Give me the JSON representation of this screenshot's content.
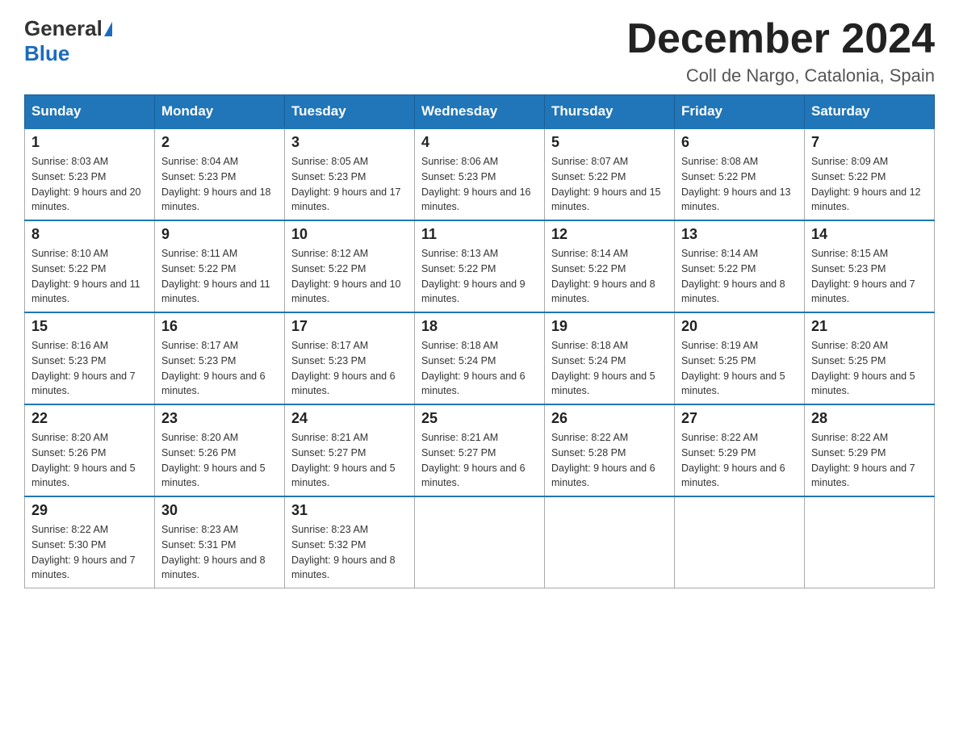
{
  "logo": {
    "general": "General",
    "blue": "Blue"
  },
  "title": "December 2024",
  "location": "Coll de Nargo, Catalonia, Spain",
  "weekdays": [
    "Sunday",
    "Monday",
    "Tuesday",
    "Wednesday",
    "Thursday",
    "Friday",
    "Saturday"
  ],
  "weeks": [
    [
      {
        "day": "1",
        "sunrise": "8:03 AM",
        "sunset": "5:23 PM",
        "daylight": "9 hours and 20 minutes."
      },
      {
        "day": "2",
        "sunrise": "8:04 AM",
        "sunset": "5:23 PM",
        "daylight": "9 hours and 18 minutes."
      },
      {
        "day": "3",
        "sunrise": "8:05 AM",
        "sunset": "5:23 PM",
        "daylight": "9 hours and 17 minutes."
      },
      {
        "day": "4",
        "sunrise": "8:06 AM",
        "sunset": "5:23 PM",
        "daylight": "9 hours and 16 minutes."
      },
      {
        "day": "5",
        "sunrise": "8:07 AM",
        "sunset": "5:22 PM",
        "daylight": "9 hours and 15 minutes."
      },
      {
        "day": "6",
        "sunrise": "8:08 AM",
        "sunset": "5:22 PM",
        "daylight": "9 hours and 13 minutes."
      },
      {
        "day": "7",
        "sunrise": "8:09 AM",
        "sunset": "5:22 PM",
        "daylight": "9 hours and 12 minutes."
      }
    ],
    [
      {
        "day": "8",
        "sunrise": "8:10 AM",
        "sunset": "5:22 PM",
        "daylight": "9 hours and 11 minutes."
      },
      {
        "day": "9",
        "sunrise": "8:11 AM",
        "sunset": "5:22 PM",
        "daylight": "9 hours and 11 minutes."
      },
      {
        "day": "10",
        "sunrise": "8:12 AM",
        "sunset": "5:22 PM",
        "daylight": "9 hours and 10 minutes."
      },
      {
        "day": "11",
        "sunrise": "8:13 AM",
        "sunset": "5:22 PM",
        "daylight": "9 hours and 9 minutes."
      },
      {
        "day": "12",
        "sunrise": "8:14 AM",
        "sunset": "5:22 PM",
        "daylight": "9 hours and 8 minutes."
      },
      {
        "day": "13",
        "sunrise": "8:14 AM",
        "sunset": "5:22 PM",
        "daylight": "9 hours and 8 minutes."
      },
      {
        "day": "14",
        "sunrise": "8:15 AM",
        "sunset": "5:23 PM",
        "daylight": "9 hours and 7 minutes."
      }
    ],
    [
      {
        "day": "15",
        "sunrise": "8:16 AM",
        "sunset": "5:23 PM",
        "daylight": "9 hours and 7 minutes."
      },
      {
        "day": "16",
        "sunrise": "8:17 AM",
        "sunset": "5:23 PM",
        "daylight": "9 hours and 6 minutes."
      },
      {
        "day": "17",
        "sunrise": "8:17 AM",
        "sunset": "5:23 PM",
        "daylight": "9 hours and 6 minutes."
      },
      {
        "day": "18",
        "sunrise": "8:18 AM",
        "sunset": "5:24 PM",
        "daylight": "9 hours and 6 minutes."
      },
      {
        "day": "19",
        "sunrise": "8:18 AM",
        "sunset": "5:24 PM",
        "daylight": "9 hours and 5 minutes."
      },
      {
        "day": "20",
        "sunrise": "8:19 AM",
        "sunset": "5:25 PM",
        "daylight": "9 hours and 5 minutes."
      },
      {
        "day": "21",
        "sunrise": "8:20 AM",
        "sunset": "5:25 PM",
        "daylight": "9 hours and 5 minutes."
      }
    ],
    [
      {
        "day": "22",
        "sunrise": "8:20 AM",
        "sunset": "5:26 PM",
        "daylight": "9 hours and 5 minutes."
      },
      {
        "day": "23",
        "sunrise": "8:20 AM",
        "sunset": "5:26 PM",
        "daylight": "9 hours and 5 minutes."
      },
      {
        "day": "24",
        "sunrise": "8:21 AM",
        "sunset": "5:27 PM",
        "daylight": "9 hours and 5 minutes."
      },
      {
        "day": "25",
        "sunrise": "8:21 AM",
        "sunset": "5:27 PM",
        "daylight": "9 hours and 6 minutes."
      },
      {
        "day": "26",
        "sunrise": "8:22 AM",
        "sunset": "5:28 PM",
        "daylight": "9 hours and 6 minutes."
      },
      {
        "day": "27",
        "sunrise": "8:22 AM",
        "sunset": "5:29 PM",
        "daylight": "9 hours and 6 minutes."
      },
      {
        "day": "28",
        "sunrise": "8:22 AM",
        "sunset": "5:29 PM",
        "daylight": "9 hours and 7 minutes."
      }
    ],
    [
      {
        "day": "29",
        "sunrise": "8:22 AM",
        "sunset": "5:30 PM",
        "daylight": "9 hours and 7 minutes."
      },
      {
        "day": "30",
        "sunrise": "8:23 AM",
        "sunset": "5:31 PM",
        "daylight": "9 hours and 8 minutes."
      },
      {
        "day": "31",
        "sunrise": "8:23 AM",
        "sunset": "5:32 PM",
        "daylight": "9 hours and 8 minutes."
      },
      null,
      null,
      null,
      null
    ]
  ]
}
